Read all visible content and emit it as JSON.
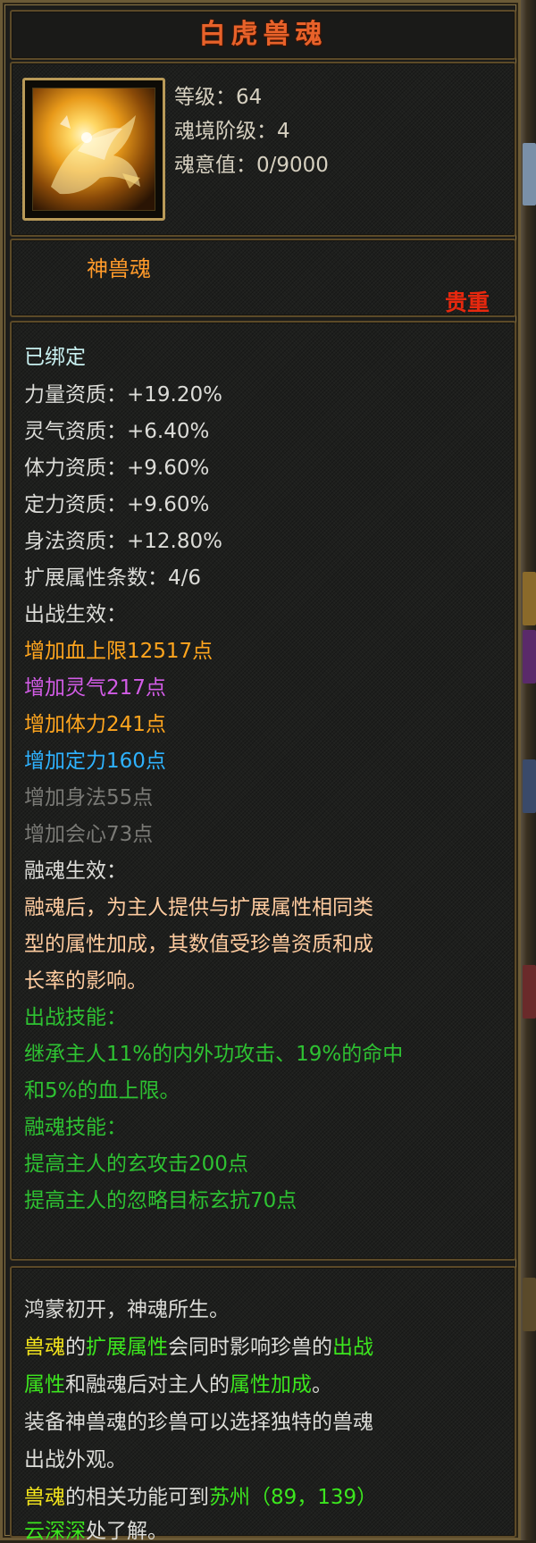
{
  "title": "白虎兽魂",
  "colors": {
    "title": "#e8622a",
    "quality": "#e8280e",
    "orange": "#ffa51e",
    "purple": "#d25ce6",
    "blue": "#2eb2ff",
    "grey": "#7a7a76",
    "skill": "#2ec232",
    "highlight_yellow": "#f2e41c",
    "highlight_green": "#3ce61e"
  },
  "icon": {
    "name": "white-tiger-soul-icon"
  },
  "info": {
    "level": "等级：64",
    "realm_stage": "魂境阶级：4",
    "soul_value": "魂意值：0/9000"
  },
  "category": "神兽魂",
  "quality": "贵重",
  "attributes": {
    "bound": "已绑定",
    "aptitudes": [
      "力量资质：+19.20%",
      "灵气资质：+6.40%",
      "体力资质：+9.60%",
      "定力资质：+9.60%",
      "身法资质：+12.80%"
    ],
    "ext_count": "扩展属性条数：4/6",
    "battle_effect_label": "出战生效：",
    "battle_effects": [
      {
        "text": "增加血上限12517点",
        "color": "orange"
      },
      {
        "text": "增加灵气217点",
        "color": "purple"
      },
      {
        "text": "增加体力241点",
        "color": "orange"
      },
      {
        "text": "增加定力160点",
        "color": "blue"
      },
      {
        "text": "增加身法55点",
        "color": "grey"
      },
      {
        "text": "增加会心73点",
        "color": "grey"
      }
    ],
    "fusion_effect_label": "融魂生效：",
    "fusion_effect_lines": [
      "融魂后，为主人提供与扩展属性相同类",
      "型的属性加成，其数值受珍兽资质和成",
      "长率的影响。"
    ],
    "battle_skill_label": "出战技能：",
    "battle_skill_lines": [
      "继承主人11%的内外功攻击、19%的命中",
      "和5%的血上限。"
    ],
    "fusion_skill_label": "融魂技能：",
    "fusion_skills": [
      "提高主人的玄攻击200点",
      "提高主人的忽略目标玄抗70点"
    ]
  },
  "description": {
    "l1": "鸿蒙初开，神魂所生。",
    "l2": {
      "a": "兽魂",
      "b": "的",
      "c": "扩展属性",
      "d": "会同时影响珍兽的",
      "e": "出战"
    },
    "l3": {
      "a": "属性",
      "b": "和融魂后对主人的",
      "c": "属性加成",
      "d": "。"
    },
    "l4": "装备神兽魂的珍兽可以选择独特的兽魂",
    "l5": "出战外观。",
    "l6": {
      "a": "兽魂",
      "b": "的相关功能可到",
      "c": "苏州（89，139）"
    },
    "l7": {
      "a": "云深深",
      "b": "处了解。"
    }
  }
}
